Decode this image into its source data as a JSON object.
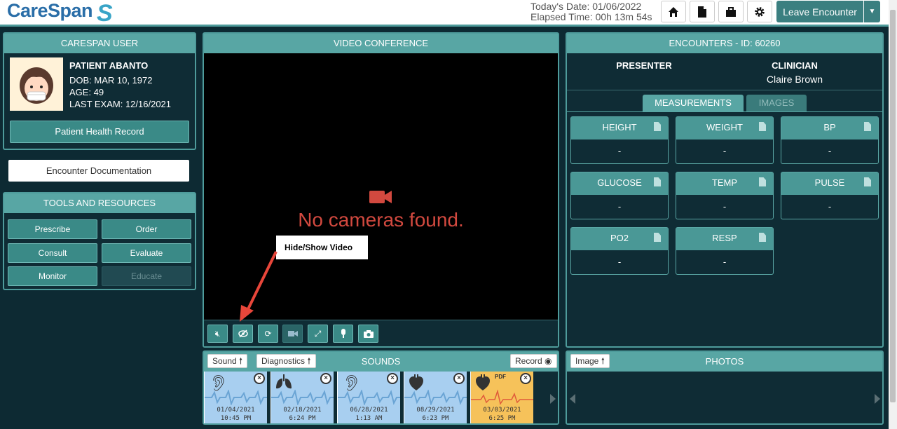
{
  "header": {
    "logo": "CareSpan",
    "date_line": "Today's Date: 01/06/2022",
    "elapsed_line": "Elapsed Time: 00h 13m 54s",
    "leave_label": "Leave Encounter"
  },
  "user_panel": {
    "title": "CARESPAN USER",
    "name": "PATIENT ABANTO",
    "dob": "DOB: MAR 10, 1972",
    "age": "AGE: 49",
    "last_exam": "LAST EXAM: 12/16/2021",
    "phr_label": "Patient Health Record"
  },
  "encounter_doc_label": "Encounter Documentation",
  "tools": {
    "title": "TOOLS AND RESOURCES",
    "items": [
      "Prescribe",
      "Order",
      "Consult",
      "Evaluate",
      "Monitor",
      "Educate"
    ]
  },
  "video": {
    "title": "VIDEO CONFERENCE",
    "message": "No cameras found.",
    "callout": "Hide/Show Video"
  },
  "encounters": {
    "title": "ENCOUNTERS - ID: 60260",
    "presenter_label": "PRESENTER",
    "clinician_label": "CLINICIAN",
    "clinician_name": "Claire Brown",
    "tabs": [
      "MEASUREMENTS",
      "IMAGES"
    ],
    "measurements": [
      {
        "name": "HEIGHT",
        "value": "-"
      },
      {
        "name": "WEIGHT",
        "value": "-"
      },
      {
        "name": "BP",
        "value": "-"
      },
      {
        "name": "GLUCOSE",
        "value": "-"
      },
      {
        "name": "TEMP",
        "value": "-"
      },
      {
        "name": "PULSE",
        "value": "-"
      },
      {
        "name": "PO2",
        "value": "-"
      },
      {
        "name": "RESP",
        "value": "-"
      }
    ]
  },
  "sounds": {
    "title": "SOUNDS",
    "sound_btn": "Sound",
    "diag_btn": "Diagnostics",
    "record_btn": "Record",
    "cards": [
      {
        "icon": "ear-icon",
        "date": "01/04/2021",
        "time": "10:45 PM"
      },
      {
        "icon": "lungs-icon",
        "date": "02/18/2021",
        "time": "6:24 PM"
      },
      {
        "icon": "ear-icon",
        "date": "06/28/2021",
        "time": "1:13 AM"
      },
      {
        "icon": "heart-icon",
        "date": "08/29/2021",
        "time": "6:23 PM"
      },
      {
        "icon": "heart-icon",
        "date": "03/03/2021",
        "time": "6:25 PM",
        "badge": "PDF"
      }
    ]
  },
  "photos": {
    "title": "PHOTOS",
    "image_btn": "Image"
  }
}
